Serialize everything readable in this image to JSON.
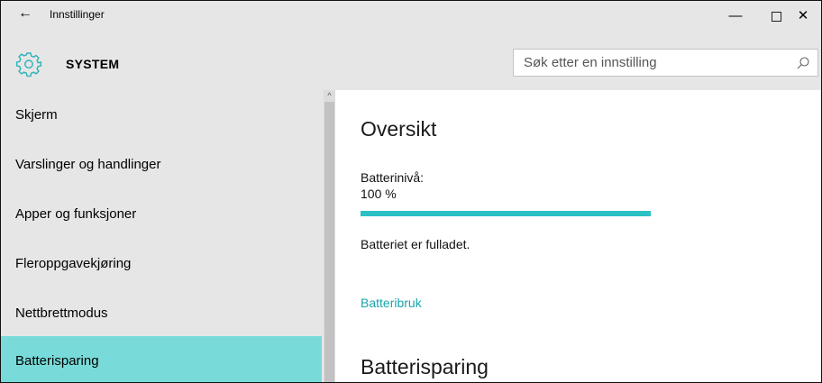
{
  "window": {
    "back_icon": "←",
    "title": "Innstillinger",
    "controls": {
      "minimize": "—",
      "close": "✕"
    }
  },
  "header": {
    "icon": "gear-icon",
    "title": "SYSTEM",
    "search_placeholder": "Søk etter en innstilling",
    "search_icon": "search-icon"
  },
  "sidebar": {
    "items": [
      {
        "label": "Skjerm",
        "selected": false
      },
      {
        "label": "Varslinger og handlinger",
        "selected": false
      },
      {
        "label": "Apper og funksjoner",
        "selected": false
      },
      {
        "label": "Fleroppgavekjøring",
        "selected": false
      },
      {
        "label": "Nettbrettmodus",
        "selected": false
      },
      {
        "label": "Batterisparing",
        "selected": true
      }
    ],
    "selected_color": "#78dbd9"
  },
  "content": {
    "section_title": "Oversikt",
    "battery_label": "Batterinivå:",
    "battery_value": "100 %",
    "battery_level": 1.0,
    "battery_status": "Batteriet er fulladet.",
    "battery_usage_link": "Batteribruk",
    "section2_title": "Batterisparing"
  },
  "colors": {
    "accent": "#2bc0c4",
    "link": "#1aa5aa",
    "chrome": "#e6e6e6"
  }
}
